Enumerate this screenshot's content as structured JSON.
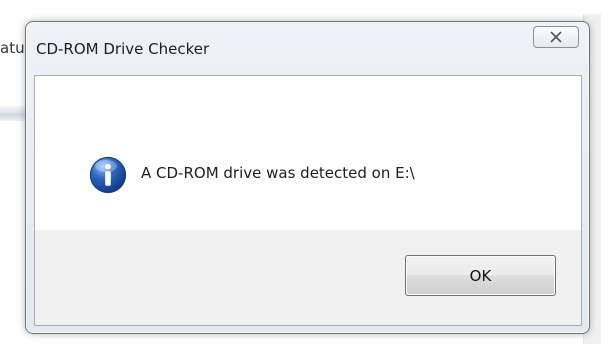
{
  "background": {
    "partial_text": "atu"
  },
  "dialog": {
    "title": "CD-ROM Drive Checker",
    "message": "A CD-ROM drive was detected on E:\\",
    "icon": "info-icon",
    "ok_label": "OK",
    "close_icon": "close-icon"
  },
  "colors": {
    "info_icon": "#2f68c3",
    "footer": "#f0f0f0",
    "frame": "#e3e8ef"
  }
}
